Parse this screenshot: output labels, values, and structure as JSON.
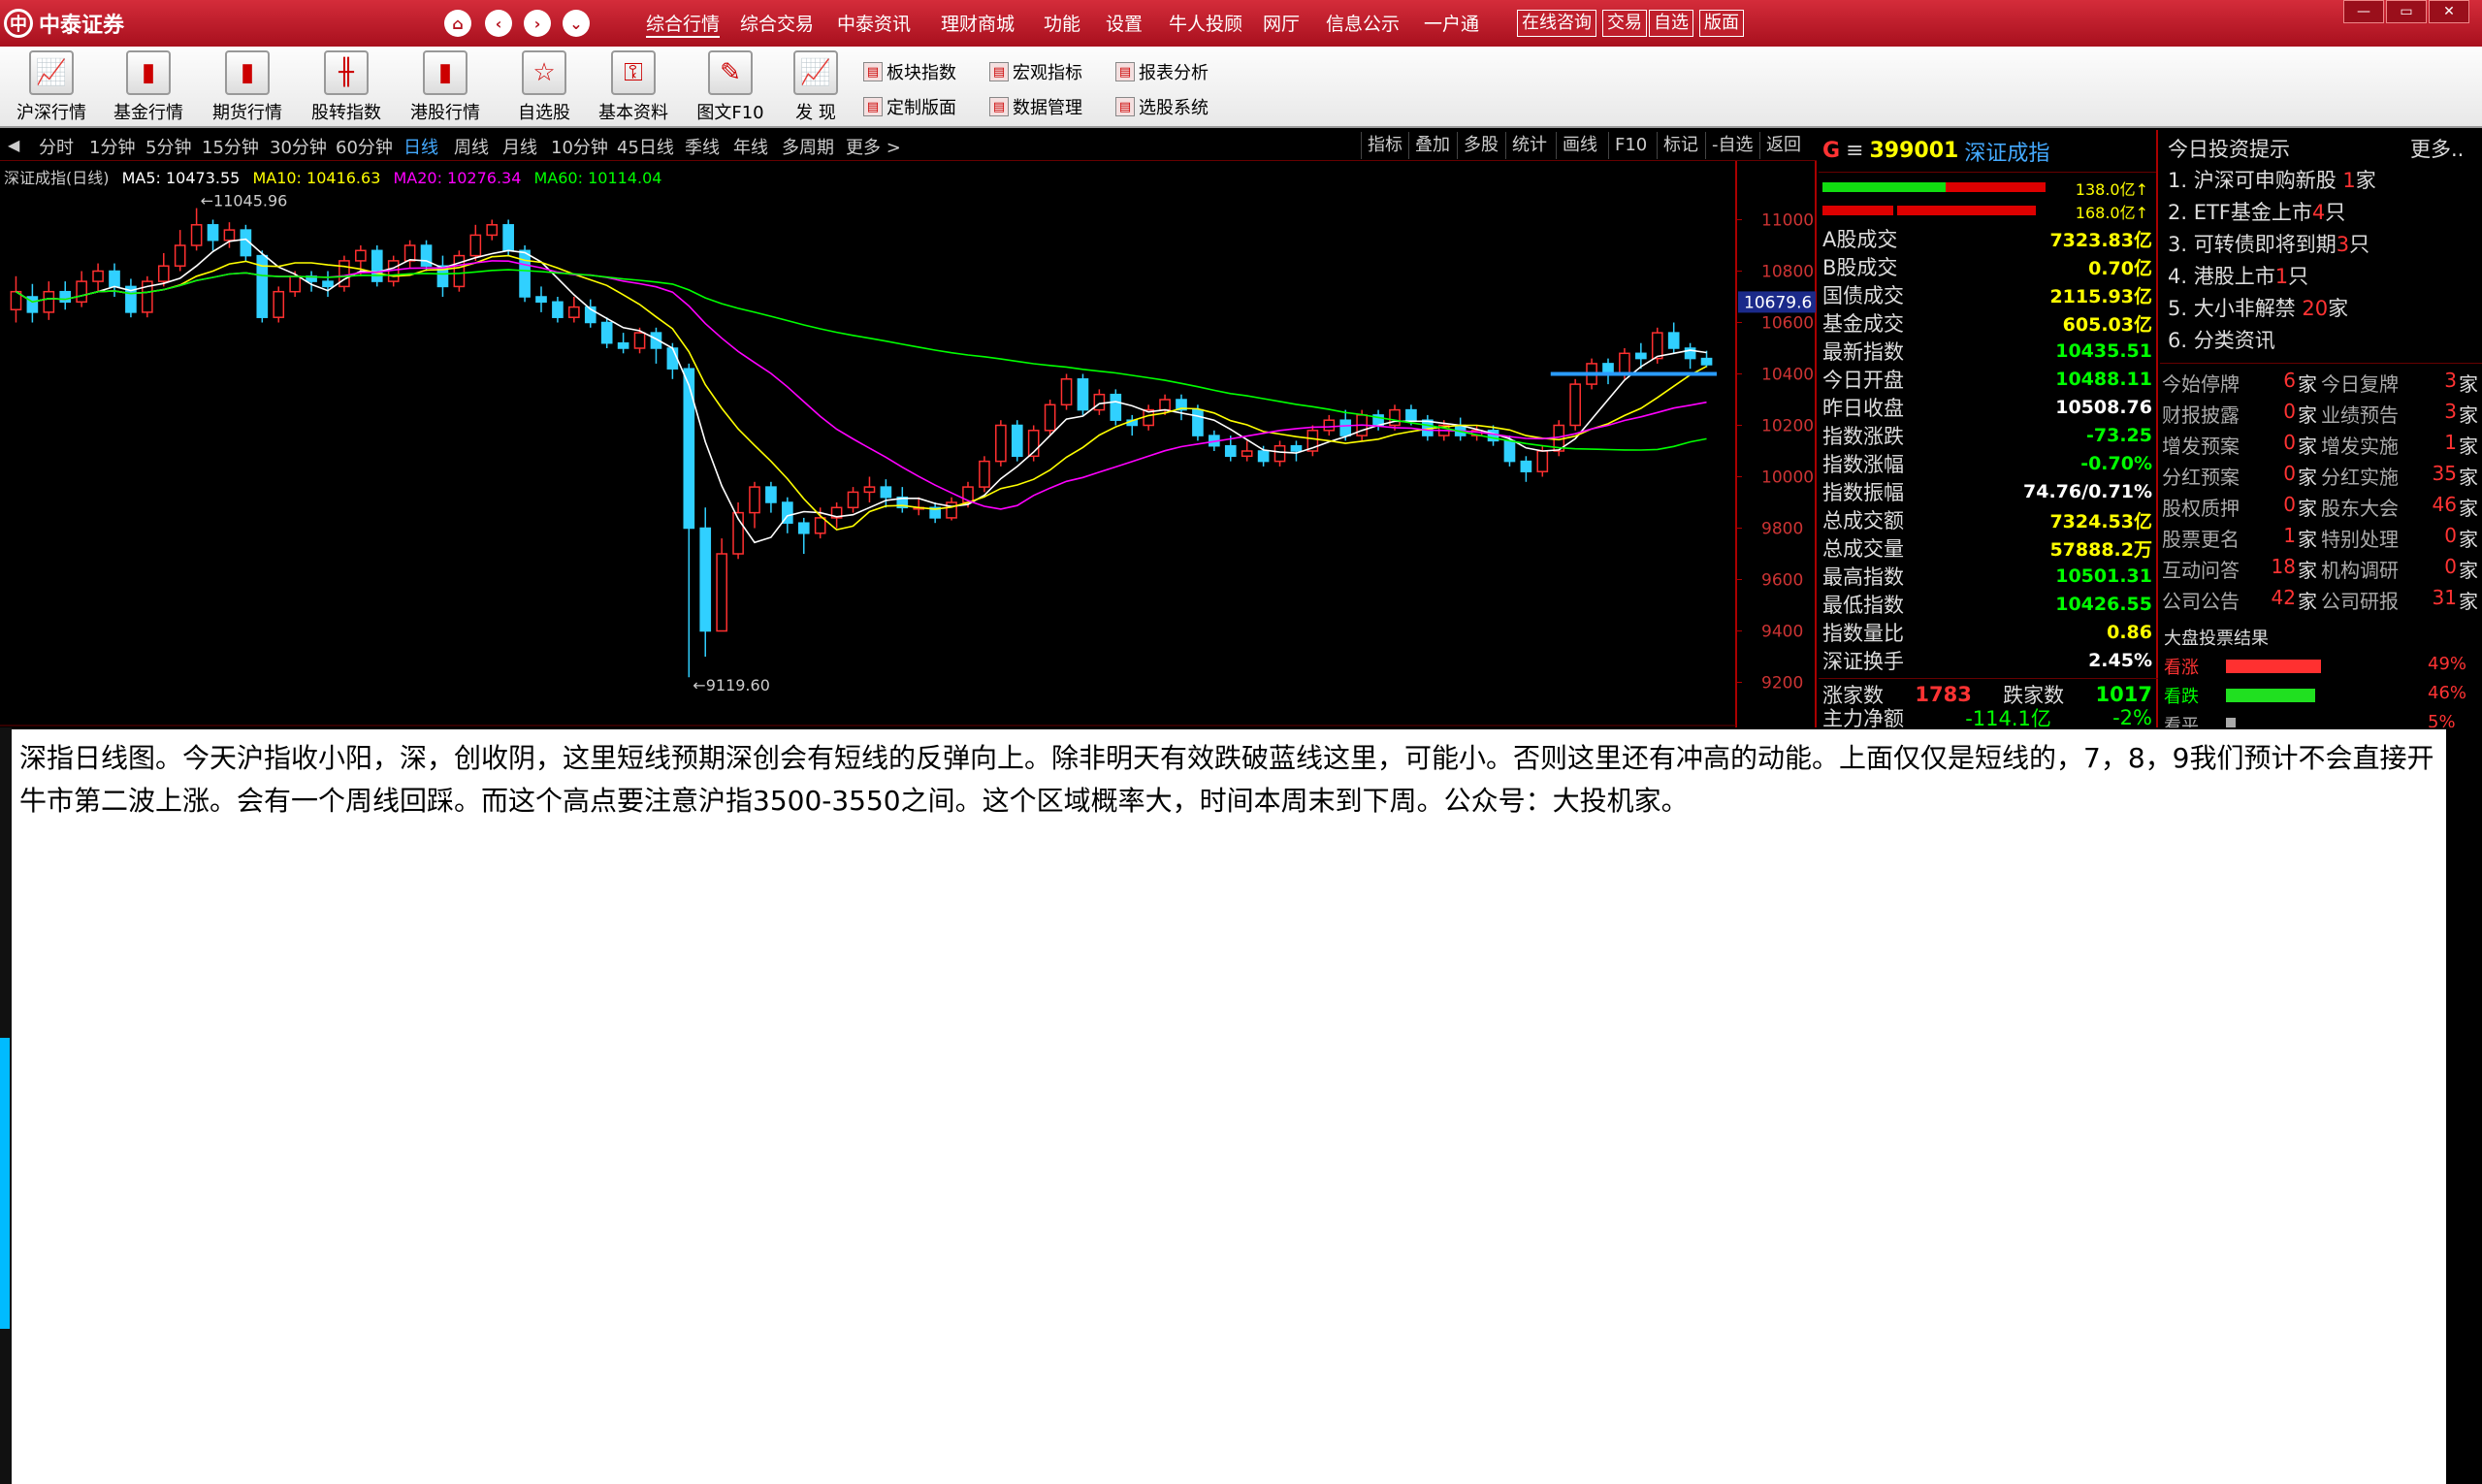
{
  "app": {
    "logo_text": "中泰证券"
  },
  "menu": [
    "综合行情",
    "综合交易",
    "中泰资讯",
    "理财商城",
    "功能",
    "设置",
    "牛人投顾",
    "网厅",
    "信息公示",
    "一户通"
  ],
  "menu_active": 0,
  "top_buttons": [
    "在线咨询",
    "交易",
    "自选",
    "版面"
  ],
  "toolbar": {
    "big": [
      {
        "label": "沪深行情",
        "icon": "chart-line-icon"
      },
      {
        "label": "基金行情",
        "icon": "bar-chart-icon"
      },
      {
        "label": "期货行情",
        "icon": "bar-chart-icon"
      },
      {
        "label": "股转指数",
        "icon": "candle-icon"
      },
      {
        "label": "港股行情",
        "icon": "bar-chart-icon"
      },
      {
        "label": "自选股",
        "icon": "star-icon"
      },
      {
        "label": "基本资料",
        "icon": "key-icon"
      },
      {
        "label": "图文F10",
        "icon": "pen-icon"
      },
      {
        "label": "发  现",
        "icon": "chart-line-icon"
      }
    ],
    "small": [
      {
        "label": "板块指数",
        "icon": "grid-icon"
      },
      {
        "label": "定制版面",
        "icon": "layout-icon"
      },
      {
        "label": "宏观指标",
        "icon": "gauge-icon"
      },
      {
        "label": "数据管理",
        "icon": "db-icon"
      },
      {
        "label": "报表分析",
        "icon": "report-icon"
      },
      {
        "label": "选股系统",
        "icon": "filter-icon"
      }
    ]
  },
  "periods": [
    "分时",
    "1分钟",
    "5分钟",
    "15分钟",
    "30分钟",
    "60分钟",
    "日线",
    "周线",
    "月线",
    "10分钟",
    "45日线",
    "季线",
    "年线",
    "多周期",
    "更多 >"
  ],
  "period_active": 6,
  "chart_tools": [
    "指标",
    "叠加",
    "多股",
    "统计",
    "画线",
    "F10",
    "标记",
    "-自选",
    "返回"
  ],
  "legend": {
    "title": "深证成指(日线)",
    "ma5": "MA5: 10473.55",
    "ma10": "MA10: 10416.63",
    "ma20": "MA20: 10276.34",
    "ma60": "MA60: 10114.04",
    "colors": {
      "ma5": "#ffffff",
      "ma10": "#ffff00",
      "ma20": "#ff00ff",
      "ma60": "#00ff00"
    }
  },
  "chart_data": {
    "type": "candlestick",
    "title": "深证成指(日线)",
    "y_ticks": [
      11000,
      10800,
      10600,
      10400,
      10200,
      10000,
      9800,
      9600,
      9400,
      9200
    ],
    "ylim": [
      9100,
      11100
    ],
    "current_price_label": "10679.6",
    "high_label": "11045.96",
    "low_label": "9119.60",
    "support_line": 10400,
    "candles": [
      [
        10650,
        10720,
        10780,
        10600
      ],
      [
        10700,
        10640,
        10750,
        10600
      ],
      [
        10640,
        10720,
        10760,
        10610
      ],
      [
        10720,
        10680,
        10760,
        10650
      ],
      [
        10680,
        10760,
        10800,
        10660
      ],
      [
        10760,
        10800,
        10830,
        10720
      ],
      [
        10800,
        10740,
        10830,
        10700
      ],
      [
        10740,
        10640,
        10770,
        10620
      ],
      [
        10640,
        10760,
        10780,
        10620
      ],
      [
        10760,
        10820,
        10870,
        10740
      ],
      [
        10820,
        10900,
        10960,
        10800
      ],
      [
        10900,
        10980,
        11045,
        10880
      ],
      [
        10980,
        10920,
        11000,
        10880
      ],
      [
        10920,
        10960,
        10990,
        10890
      ],
      [
        10960,
        10860,
        10980,
        10840
      ],
      [
        10860,
        10620,
        10880,
        10600
      ],
      [
        10620,
        10720,
        10740,
        10600
      ],
      [
        10720,
        10780,
        10800,
        10700
      ],
      [
        10780,
        10760,
        10800,
        10720
      ],
      [
        10760,
        10740,
        10800,
        10700
      ],
      [
        10740,
        10840,
        10860,
        10720
      ],
      [
        10840,
        10880,
        10900,
        10780
      ],
      [
        10880,
        10760,
        10900,
        10740
      ],
      [
        10760,
        10840,
        10860,
        10740
      ],
      [
        10840,
        10900,
        10920,
        10810
      ],
      [
        10900,
        10820,
        10920,
        10800
      ],
      [
        10820,
        10740,
        10860,
        10700
      ],
      [
        10740,
        10860,
        10880,
        10720
      ],
      [
        10860,
        10940,
        10980,
        10840
      ],
      [
        10940,
        10980,
        11000,
        10920
      ],
      [
        10980,
        10880,
        11000,
        10860
      ],
      [
        10880,
        10700,
        10900,
        10680
      ],
      [
        10700,
        10680,
        10740,
        10640
      ],
      [
        10680,
        10620,
        10700,
        10600
      ],
      [
        10620,
        10660,
        10700,
        10600
      ],
      [
        10660,
        10600,
        10690,
        10580
      ],
      [
        10600,
        10520,
        10620,
        10500
      ],
      [
        10520,
        10500,
        10560,
        10480
      ],
      [
        10500,
        10560,
        10580,
        10480
      ],
      [
        10560,
        10500,
        10580,
        10440
      ],
      [
        10500,
        10420,
        10520,
        10380
      ],
      [
        10420,
        9800,
        10440,
        9220
      ],
      [
        9800,
        9400,
        9880,
        9300
      ],
      [
        9400,
        9700,
        9760,
        9600
      ],
      [
        9700,
        9860,
        9900,
        9680
      ],
      [
        9860,
        9960,
        9980,
        9800
      ],
      [
        9960,
        9900,
        9980,
        9860
      ],
      [
        9900,
        9820,
        9920,
        9780
      ],
      [
        9820,
        9780,
        9840,
        9700
      ],
      [
        9780,
        9840,
        9880,
        9760
      ],
      [
        9840,
        9880,
        9900,
        9800
      ],
      [
        9880,
        9940,
        9960,
        9860
      ],
      [
        9940,
        9960,
        10000,
        9900
      ],
      [
        9960,
        9920,
        9990,
        9880
      ],
      [
        9920,
        9880,
        9960,
        9860
      ],
      [
        9880,
        9880,
        9920,
        9850
      ],
      [
        9880,
        9840,
        9900,
        9820
      ],
      [
        9840,
        9900,
        9920,
        9830
      ],
      [
        9900,
        9960,
        9980,
        9880
      ],
      [
        9960,
        10060,
        10080,
        9940
      ],
      [
        10060,
        10200,
        10220,
        10040
      ],
      [
        10200,
        10080,
        10220,
        10060
      ],
      [
        10080,
        10180,
        10200,
        10060
      ],
      [
        10180,
        10280,
        10300,
        10160
      ],
      [
        10280,
        10380,
        10400,
        10260
      ],
      [
        10380,
        10260,
        10400,
        10240
      ],
      [
        10260,
        10320,
        10340,
        10240
      ],
      [
        10320,
        10220,
        10340,
        10200
      ],
      [
        10220,
        10200,
        10240,
        10160
      ],
      [
        10200,
        10260,
        10280,
        10180
      ],
      [
        10260,
        10300,
        10320,
        10240
      ],
      [
        10300,
        10260,
        10320,
        10220
      ],
      [
        10260,
        10160,
        10280,
        10140
      ],
      [
        10160,
        10120,
        10180,
        10100
      ],
      [
        10120,
        10080,
        10160,
        10060
      ],
      [
        10080,
        10100,
        10140,
        10060
      ],
      [
        10100,
        10060,
        10120,
        10040
      ],
      [
        10060,
        10120,
        10140,
        10040
      ],
      [
        10120,
        10100,
        10140,
        10060
      ],
      [
        10100,
        10180,
        10200,
        10080
      ],
      [
        10180,
        10220,
        10240,
        10160
      ],
      [
        10220,
        10160,
        10260,
        10140
      ],
      [
        10160,
        10240,
        10260,
        10140
      ],
      [
        10240,
        10200,
        10260,
        10180
      ],
      [
        10200,
        10260,
        10280,
        10180
      ],
      [
        10260,
        10220,
        10280,
        10200
      ],
      [
        10220,
        10160,
        10240,
        10140
      ],
      [
        10160,
        10200,
        10220,
        10140
      ],
      [
        10200,
        10160,
        10230,
        10140
      ],
      [
        10160,
        10180,
        10200,
        10140
      ],
      [
        10180,
        10140,
        10200,
        10120
      ],
      [
        10140,
        10060,
        10160,
        10040
      ],
      [
        10060,
        10020,
        10080,
        9980
      ],
      [
        10020,
        10100,
        10120,
        10000
      ],
      [
        10100,
        10200,
        10220,
        10080
      ],
      [
        10200,
        10360,
        10380,
        10180
      ],
      [
        10360,
        10440,
        10460,
        10340
      ],
      [
        10440,
        10400,
        10460,
        10360
      ],
      [
        10400,
        10480,
        10500,
        10380
      ],
      [
        10480,
        10460,
        10520,
        10420
      ],
      [
        10460,
        10560,
        10580,
        10440
      ],
      [
        10560,
        10500,
        10600,
        10480
      ],
      [
        10500,
        10460,
        10520,
        10420
      ],
      [
        10460,
        10436,
        10490,
        10426
      ]
    ]
  },
  "quote": {
    "flag": "G",
    "code": "399001",
    "name": "深证成指",
    "bar1_value": "138.0亿↑",
    "bar2_value": "168.0亿↑",
    "rows": [
      {
        "label": "A股成交",
        "value": "7323.83亿",
        "color": "#ffff00"
      },
      {
        "label": "B股成交",
        "value": "0.70亿",
        "color": "#ffff00"
      },
      {
        "label": "国债成交",
        "value": "2115.93亿",
        "color": "#ffff00"
      },
      {
        "label": "基金成交",
        "value": "605.03亿",
        "color": "#ffff00"
      },
      {
        "label": "最新指数",
        "value": "10435.51",
        "color": "#00ff00"
      },
      {
        "label": "今日开盘",
        "value": "10488.11",
        "color": "#00ff00"
      },
      {
        "label": "昨日收盘",
        "value": "10508.76",
        "color": "#ffffff"
      },
      {
        "label": "指数涨跌",
        "value": "-73.25",
        "color": "#00ff00"
      },
      {
        "label": "指数涨幅",
        "value": "-0.70%",
        "color": "#00ff00"
      },
      {
        "label": "指数振幅",
        "value": "74.76/0.71%",
        "color": "#ffffff"
      },
      {
        "label": "总成交额",
        "value": "7324.53亿",
        "color": "#ffff00"
      },
      {
        "label": "总成交量",
        "value": "57888.2万",
        "color": "#ffff00"
      },
      {
        "label": "最高指数",
        "value": "10501.31",
        "color": "#00ff00"
      },
      {
        "label": "最低指数",
        "value": "10426.55",
        "color": "#00ff00"
      },
      {
        "label": "指数量比",
        "value": "0.86",
        "color": "#ffff00"
      },
      {
        "label": "深证换手",
        "value": "2.45%",
        "color": "#ffffff"
      }
    ],
    "up_label": "涨家数",
    "up_count": "1783",
    "down_label": "跌家数",
    "down_count": "1017",
    "extra_label": "主力净额",
    "extra_value": "-114.1亿",
    "extra_pct": "-2%"
  },
  "tips": {
    "header": "今日投资提示",
    "more": "更多..",
    "items": [
      {
        "text": "1. 沪深可申购新股 ",
        "num": "1",
        "unit": "家"
      },
      {
        "text": "2. ETF基金上市",
        "num": "4",
        "unit": "只"
      },
      {
        "text": "3. 可转债即将到期",
        "num": "3",
        "unit": "只"
      },
      {
        "text": "4. 港股上市",
        "num": "1",
        "unit": "只"
      },
      {
        "text": "5. 大小非解禁 ",
        "num": "20",
        "unit": "家"
      },
      {
        "text": "6. 分类资讯",
        "num": "",
        "unit": ""
      }
    ],
    "stats": [
      {
        "l": "今始停牌",
        "n": "6",
        "r": "今日复牌",
        "n2": "3"
      },
      {
        "l": "财报披露",
        "n": "0",
        "r": "业绩预告",
        "n2": "3"
      },
      {
        "l": "增发预案",
        "n": "0",
        "r": "增发实施",
        "n2": "1"
      },
      {
        "l": "分红预案",
        "n": "0",
        "r": "分红实施",
        "n2": "35"
      },
      {
        "l": "股权质押",
        "n": "0",
        "r": "股东大会",
        "n2": "46"
      },
      {
        "l": "股票更名",
        "n": "1",
        "r": "特别处理",
        "n2": "0"
      },
      {
        "l": "互动问答",
        "n": "18",
        "r": "机构调研",
        "n2": "0"
      },
      {
        "l": "公司公告",
        "n": "42",
        "r": "公司研报",
        "n2": "31"
      }
    ],
    "unit": "家",
    "vote_title": "大盘投票结果",
    "votes": [
      {
        "label": "看涨",
        "pct": "49%",
        "color": "#ff3030",
        "frac": 0.49
      },
      {
        "label": "看跌",
        "pct": "46%",
        "color": "#20e020",
        "frac": 0.46
      },
      {
        "label": "看平",
        "pct": "5%",
        "color": "#aaaaaa",
        "frac": 0.05
      }
    ]
  },
  "note": "深指日线图。今天沪指收小阳，深，创收阴，这里短线预期深创会有短线的反弹向上。除非明天有效跌破蓝线这里，可能小。否则这里还有冲高的动能。上面仅仅是短线的，7，8，9我们预计不会直接开牛市第二波上涨。会有一个周线回踩。而这个高点要注意沪指3500-3550之间。这个区域概率大，时间本周末到下周。公众号：大投机家。"
}
